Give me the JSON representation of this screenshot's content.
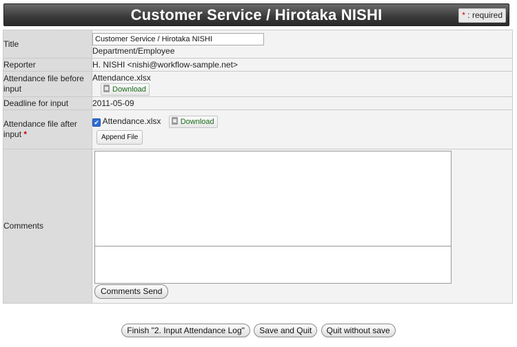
{
  "header": {
    "title": "Customer Service / Hirotaka NISHI",
    "required_star": "*",
    "required_text": " : required"
  },
  "form": {
    "title": {
      "label": "Title",
      "input_value": "Customer Service / Hirotaka NISHI",
      "sub_text": "Department/Employee"
    },
    "reporter": {
      "label": "Reporter",
      "value": "H. NISHI <nishi@workflow-sample.net>"
    },
    "attendance_before": {
      "label": "Attendance file before input",
      "filename": "Attendance.xlsx",
      "download_label": "Download"
    },
    "deadline": {
      "label": "Deadline for input",
      "value": "2011-05-09"
    },
    "attendance_after": {
      "label": "Attendance file after input",
      "required_star": "*",
      "filename": "Attendance.xlsx",
      "checked_mark": "✔",
      "download_label": "Download",
      "append_label": "Append File"
    },
    "comments": {
      "label": "Comments",
      "send_label": "Comments Send"
    }
  },
  "footer": {
    "finish_label": "Finish \"2. Input Attendance Log\"",
    "save_quit_label": "Save and Quit",
    "quit_nosave_label": "Quit without save"
  }
}
